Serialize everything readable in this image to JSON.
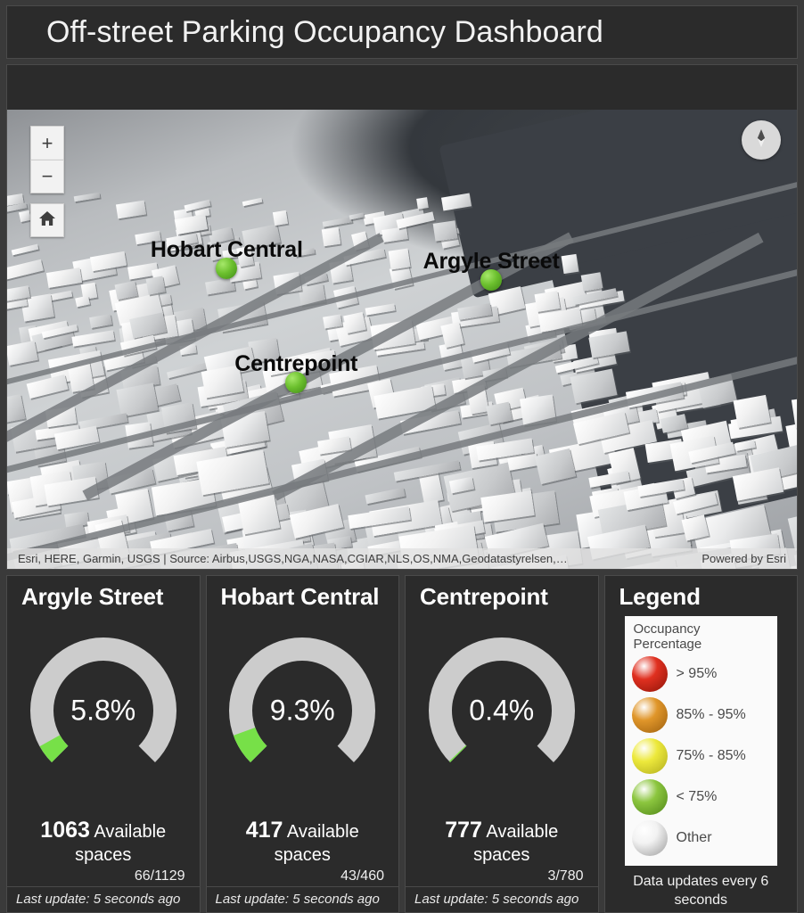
{
  "header": {
    "title": "Off-street Parking Occupancy Dashboard"
  },
  "map": {
    "zoom_in_label": "+",
    "zoom_out_label": "−",
    "home_icon": "home-icon",
    "compass_icon": "compass-icon",
    "attribution_source": "Esri, HERE, Garmin, USGS | Source: Airbus,USGS,NGA,NASA,CGIAR,NLS,OS,NMA,Geodatastyrelsen,…",
    "attribution_powered": "Powered by Esri",
    "markers": [
      {
        "label": "Hobart Central",
        "color": "#6cc02e",
        "x": 27.8,
        "y": 34.5
      },
      {
        "label": "Argyle Street",
        "color": "#6cc02e",
        "x": 61.3,
        "y": 37.0
      },
      {
        "label": "Centrepoint",
        "color": "#6cc02e",
        "x": 36.6,
        "y": 59.4
      }
    ]
  },
  "cards": [
    {
      "title": "Argyle Street",
      "percent_label": "5.8%",
      "percent_value": 5.8,
      "available_number": "1063",
      "available_label": "Available spaces",
      "ratio": "66/1129",
      "footer": "Last update: 5 seconds ago",
      "arc_color": "#77e048"
    },
    {
      "title": "Hobart Central",
      "percent_label": "9.3%",
      "percent_value": 9.3,
      "available_number": "417",
      "available_label": "Available spaces",
      "ratio": "43/460",
      "footer": "Last update: 5 seconds ago",
      "arc_color": "#77e048"
    },
    {
      "title": "Centrepoint",
      "percent_label": "0.4%",
      "percent_value": 0.4,
      "available_number": "777",
      "available_label": "Available spaces",
      "ratio": "3/780",
      "footer": "Last update: 5 seconds ago",
      "arc_color": "#77e048"
    }
  ],
  "legend": {
    "title": "Legend",
    "heading": "Occupancy Percentage",
    "items": [
      {
        "label": "> 95%",
        "color": "#e03020",
        "shade": "#8e1408"
      },
      {
        "label": "85% - 95%",
        "color": "#e0962a",
        "shade": "#9c5f0e"
      },
      {
        "label": "75% - 85%",
        "color": "#ede93c",
        "shade": "#b0ac1e"
      },
      {
        "label": "< 75%",
        "color": "#8cc63f",
        "shade": "#4e8416"
      },
      {
        "label": "Other",
        "color": "#f2f2f2",
        "shade": "#9a9a9a"
      }
    ],
    "note": "Data updates every 6 seconds"
  },
  "gauge": {
    "track_color": "#cccccc",
    "stroke_width": 26,
    "start_angle": -225,
    "sweep_angle": 270
  }
}
